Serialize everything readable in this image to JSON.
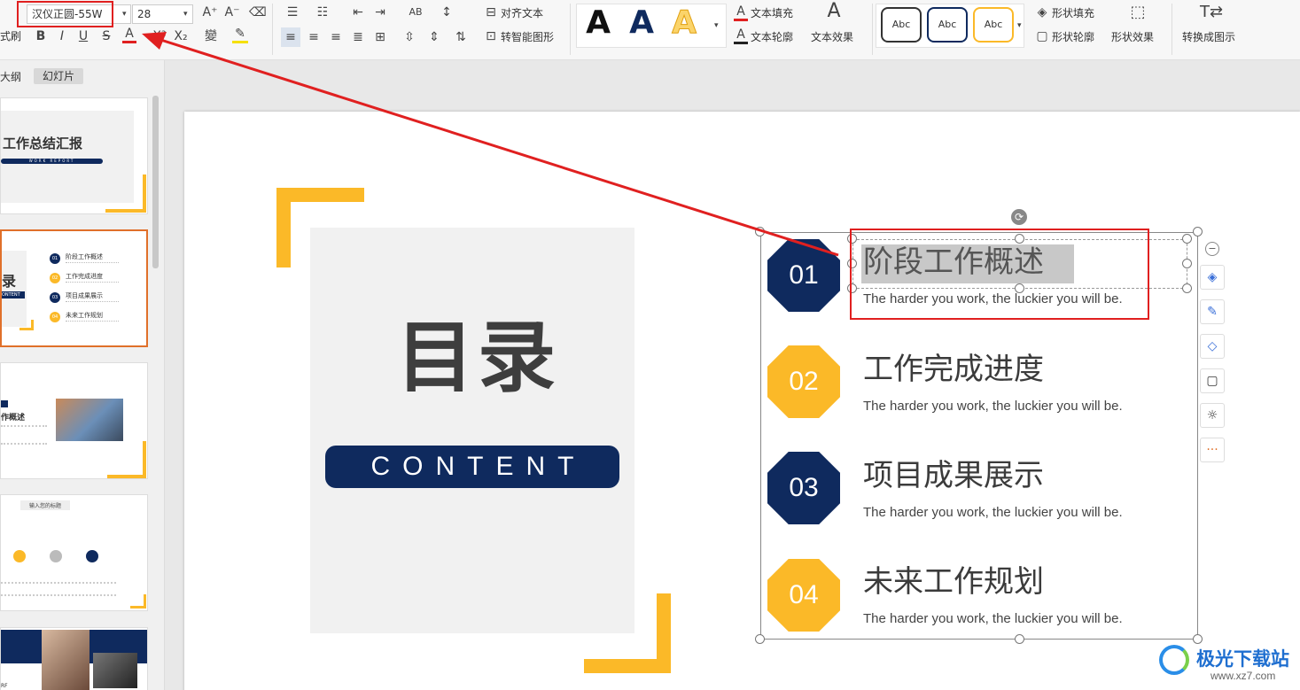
{
  "toolbar": {
    "font_name": "汉仪正圆-55W",
    "font_size": "28",
    "format_painter_tail": "式刷",
    "align_text": "对齐文本",
    "smart_art": "转智能图形",
    "text_fill": "文本填充",
    "text_outline": "文本轮廓",
    "text_effect": "文本效果",
    "shape_fill": "形状填充",
    "shape_outline": "形状轮廓",
    "shape_effect": "形状效果",
    "convert": "转换成图示",
    "style_abc": "Abc",
    "wordart_a": "A"
  },
  "panel": {
    "tab_outline": "大纲",
    "tab_slides": "幻灯片",
    "thumb1_title": "工作总结汇报",
    "thumb1_sub": "WORK REPORT",
    "thumb2_mark": "录",
    "thumb2_word": "ONTENT",
    "thumb2_items": [
      {
        "n": "01",
        "t": "阶段工作概述"
      },
      {
        "n": "02",
        "t": "工作完成进度"
      },
      {
        "n": "03",
        "t": "项目成果展示"
      },
      {
        "n": "04",
        "t": "未来工作规划"
      }
    ],
    "thumb3_title": "作概述",
    "thumb4_title": "输入您的标题",
    "thumb5_tail": "RF"
  },
  "slide": {
    "mulu": "目录",
    "content": "CONTENT",
    "items": [
      {
        "num": "01",
        "title": "阶段工作概述",
        "sub": "The harder you work, the luckier you will be.",
        "color": "#0f2a5e"
      },
      {
        "num": "02",
        "title": "工作完成进度",
        "sub": "The harder you work, the luckier you will be.",
        "color": "#fbb928"
      },
      {
        "num": "03",
        "title": "项目成果展示",
        "sub": "The harder you work, the luckier you will be.",
        "color": "#0f2a5e"
      },
      {
        "num": "04",
        "title": "未来工作规划",
        "sub": "The harder you work, the luckier you will be.",
        "color": "#fbb928"
      }
    ]
  },
  "watermark": {
    "name": "极光下载站",
    "url": "www.xz7.com"
  },
  "colors": {
    "navy": "#0f2a5e",
    "gold": "#fbb928",
    "highlight": "#e02020"
  }
}
